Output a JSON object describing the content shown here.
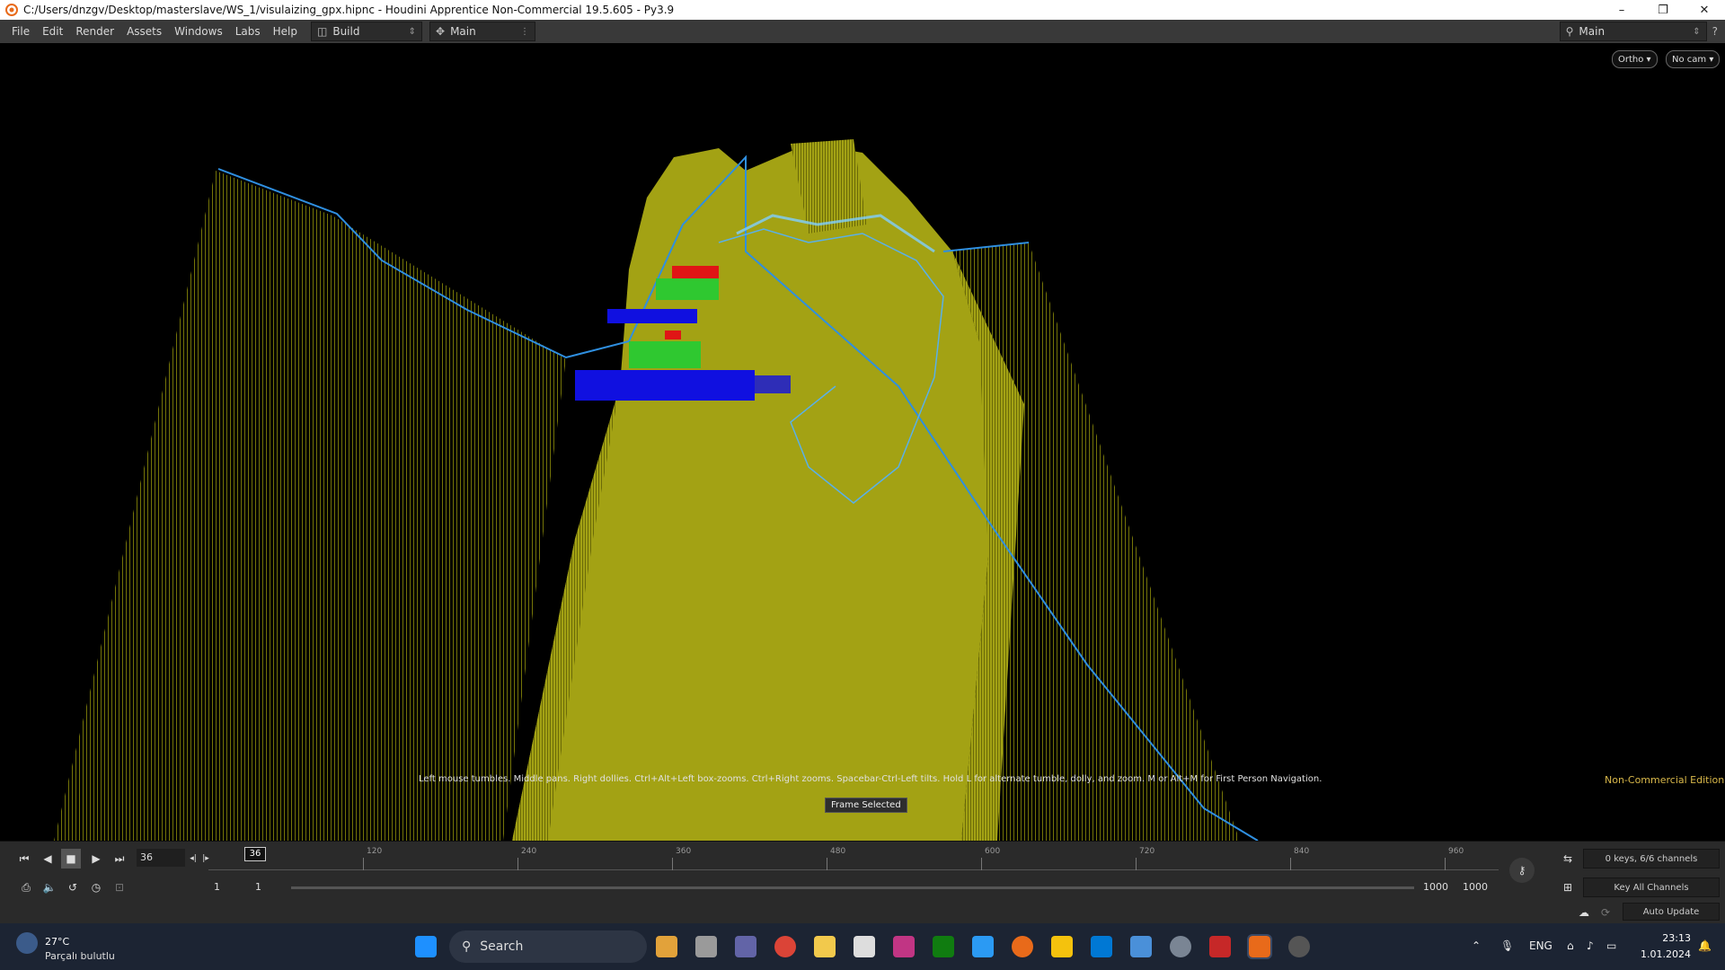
{
  "window": {
    "title": "C:/Users/dnzgv/Desktop/masterslave/WS_1/visulaizing_gpx.hipnc - Houdini Apprentice Non-Commercial 19.5.605 - Py3.9",
    "minimize": "–",
    "maximize": "❐",
    "close": "✕"
  },
  "menu": {
    "items": [
      "File",
      "Edit",
      "Render",
      "Assets",
      "Windows",
      "Labs",
      "Help"
    ],
    "desktop_build": "Build",
    "desktop_main": "Main",
    "right_desktop": "Main"
  },
  "viewport": {
    "ortho_btn": "Ortho ▾",
    "cam_btn": "No cam ▾",
    "hint": "Left mouse tumbles. Middle pans. Right dollies. Ctrl+Alt+Left box-zooms. Ctrl+Right zooms. Spacebar-Ctrl-Left tilts. Hold L for alternate tumble, dolly, and zoom.     M or Alt+M for First Person Navigation.",
    "frame_selected": "Frame Selected",
    "edition": "Non-Commercial Edition"
  },
  "playbar": {
    "current_frame": "36",
    "cursor_frame": "36",
    "ruler_labels": [
      "120",
      "240",
      "360",
      "480",
      "600",
      "720",
      "840",
      "960"
    ],
    "start_frame": "1",
    "start_frame2": "1",
    "end_frame": "1000",
    "end_frame2": "1000",
    "keys_info": "0 keys, 6/6 channels",
    "key_all": "Key All Channels",
    "auto_update": "Auto Update"
  },
  "taskbar": {
    "weather_temp": "27°C",
    "weather_desc": "Parçalı bulutlu",
    "search": "Search",
    "lang": "ENG",
    "time": "23:13",
    "date": "1.01.2024"
  },
  "colors": {
    "terrain": "#a3a214",
    "path": "#2f8fe0",
    "accent_red": "#e01515",
    "accent_blue": "#1010e0",
    "accent_green": "#22cc33"
  }
}
